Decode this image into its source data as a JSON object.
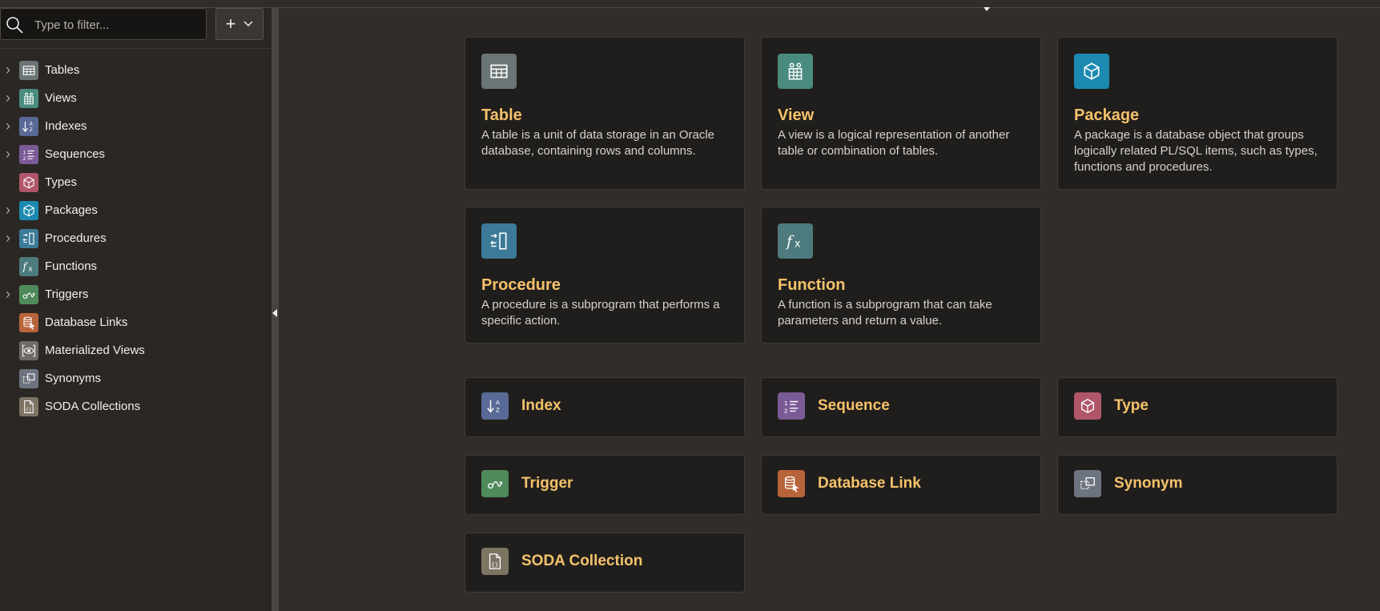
{
  "search": {
    "placeholder": "Type to filter..."
  },
  "add_button": {
    "label": "+"
  },
  "tree": [
    {
      "label": "Tables",
      "icon": "table-icon",
      "color": "#6b7575",
      "expandable": true
    },
    {
      "label": "Views",
      "icon": "view-icon",
      "color": "#4a8b7f",
      "expandable": true
    },
    {
      "label": "Indexes",
      "icon": "index-icon",
      "color": "#5a6a96",
      "expandable": true
    },
    {
      "label": "Sequences",
      "icon": "sequence-icon",
      "color": "#7b5b96",
      "expandable": true
    },
    {
      "label": "Types",
      "icon": "type-icon",
      "color": "#b0566b",
      "expandable": false
    },
    {
      "label": "Packages",
      "icon": "package-icon",
      "color": "#1c8ab0",
      "expandable": true
    },
    {
      "label": "Procedures",
      "icon": "procedure-icon",
      "color": "#3c7a98",
      "expandable": true
    },
    {
      "label": "Functions",
      "icon": "function-icon",
      "color": "#4d7a7c",
      "expandable": false
    },
    {
      "label": "Triggers",
      "icon": "trigger-icon",
      "color": "#4f8a5b",
      "expandable": true
    },
    {
      "label": "Database Links",
      "icon": "database-link-icon",
      "color": "#b8643a",
      "expandable": false
    },
    {
      "label": "Materialized Views",
      "icon": "materialized-view-icon",
      "color": "#6e6a66",
      "expandable": false
    },
    {
      "label": "Synonyms",
      "icon": "synonym-icon",
      "color": "#6d7480",
      "expandable": false
    },
    {
      "label": "SODA Collections",
      "icon": "soda-collection-icon",
      "color": "#7d7563",
      "expandable": false
    }
  ],
  "cards": [
    {
      "title": "Table",
      "desc": "A table is a unit of data storage in an Oracle database, containing rows and columns.",
      "icon": "table-icon",
      "color": "#6b7575"
    },
    {
      "title": "View",
      "desc": "A view is a logical representation of another table or combination of tables.",
      "icon": "view-icon",
      "color": "#4a8b7f"
    },
    {
      "title": "Package",
      "desc": "A package is a database object that groups logically related PL/SQL items, such as types, functions and procedures.",
      "icon": "package-icon",
      "color": "#1c8ab0"
    },
    {
      "title": "Procedure",
      "desc": "A procedure is a subprogram that performs a specific action.",
      "icon": "procedure-icon",
      "color": "#3c7a98"
    },
    {
      "title": "Function",
      "desc": "A function is a subprogram that can take parameters and return a value.",
      "icon": "function-icon",
      "color": "#4d7a7c"
    }
  ],
  "small_cards": [
    {
      "title": "Index",
      "icon": "index-icon",
      "color": "#5a6a96"
    },
    {
      "title": "Sequence",
      "icon": "sequence-icon",
      "color": "#7b5b96"
    },
    {
      "title": "Type",
      "icon": "type-icon",
      "color": "#b0566b"
    },
    {
      "title": "Trigger",
      "icon": "trigger-icon",
      "color": "#4f8a5b"
    },
    {
      "title": "Database Link",
      "icon": "database-link-icon",
      "color": "#b8643a"
    },
    {
      "title": "Synonym",
      "icon": "synonym-icon",
      "color": "#6d7480"
    },
    {
      "title": "SODA Collection",
      "icon": "soda-collection-icon",
      "color": "#7d7563"
    }
  ]
}
